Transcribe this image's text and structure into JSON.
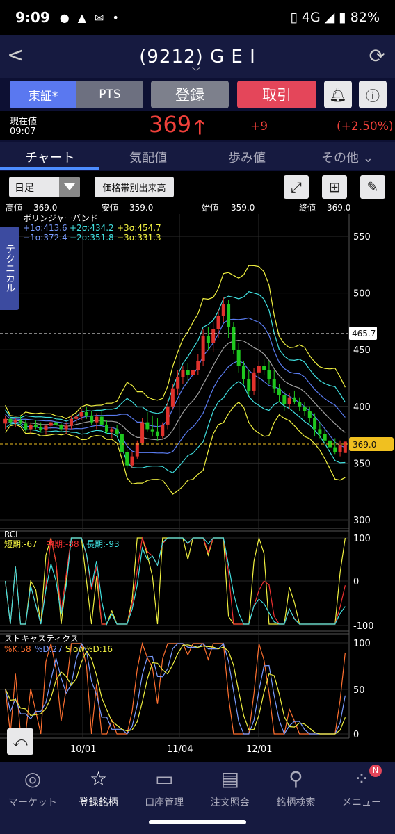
{
  "status": {
    "time": "9:09",
    "network": "4G",
    "battery": "82%"
  },
  "header": {
    "title": "(9212) G E I"
  },
  "buttons": {
    "market_tosho": "東証*",
    "market_pts": "PTS",
    "register": "登録",
    "trade": "取引"
  },
  "price": {
    "label": "現在値",
    "time": "09:07",
    "value": "369",
    "change": "+9",
    "change_pct": "(+2.50%)"
  },
  "tabs": [
    "チャート",
    "気配値",
    "歩み値",
    "その他"
  ],
  "toolbar": {
    "period": "日足",
    "volume_by_price": "価格帯別出来高"
  },
  "side_tab": "テクニカル",
  "ohlc": {
    "high_label": "高値",
    "high": "369.0",
    "low_label": "安値",
    "low": "359.0",
    "open_label": "始値",
    "open": "359.0",
    "close_label": "終値",
    "close": "369.0"
  },
  "bb_legend": {
    "title": "ボリンジャーバンド",
    "p1": "+1σ:413.6",
    "p2": "+2σ:434.2",
    "p3": "+3σ:454.7",
    "m1": "−1σ:372.4",
    "m2": "−2σ:351.8",
    "m3": "−3σ:331.3"
  },
  "rci_legend": {
    "title": "RCI",
    "short": "短期:-67",
    "mid": "中期:-88",
    "long": "長期:-93"
  },
  "stoch_legend": {
    "title": "ストキャスティクス",
    "k": "%K:58",
    "d": "%D:27",
    "slow": "Slow%D:16"
  },
  "price_axis": [
    "550",
    "500",
    "450",
    "400",
    "350",
    "300"
  ],
  "rci_axis": [
    "100",
    "0",
    "-100"
  ],
  "stoch_axis": [
    "100",
    "50",
    "0"
  ],
  "markers": {
    "upper": "465.7",
    "current": "369.0"
  },
  "dates": [
    "10/01",
    "11/04",
    "12/01"
  ],
  "colors": {
    "up": "#e0322c",
    "down": "#1ec81e",
    "bb_pm1": "#5a7cf0",
    "bb_pm2": "#40e0e0",
    "bb_pm3": "#f0f040",
    "bb_mid": "#a0a0a0",
    "price_red": "#f0403a",
    "accent": "#5a78f0"
  },
  "nav": [
    {
      "label": "マーケット",
      "icon": "globe-icon"
    },
    {
      "label": "登録銘柄",
      "icon": "star-icon"
    },
    {
      "label": "口座管理",
      "icon": "card-icon"
    },
    {
      "label": "注文照会",
      "icon": "document-icon"
    },
    {
      "label": "銘柄検索",
      "icon": "search-icon"
    },
    {
      "label": "メニュー",
      "icon": "grid-icon",
      "badge": "N"
    }
  ],
  "chart_data": [
    {
      "type": "candlestick",
      "ylim": [
        300,
        560
      ],
      "x": [
        "10/01",
        "11/04",
        "12/01"
      ],
      "candles": [
        [
          385,
          392,
          380,
          389
        ],
        [
          389,
          390,
          383,
          386
        ],
        [
          386,
          390,
          382,
          388
        ],
        [
          388,
          392,
          384,
          385
        ],
        [
          385,
          388,
          378,
          380
        ],
        [
          380,
          386,
          376,
          384
        ],
        [
          384,
          388,
          380,
          382
        ],
        [
          382,
          386,
          377,
          379
        ],
        [
          379,
          384,
          375,
          383
        ],
        [
          383,
          388,
          380,
          386
        ],
        [
          386,
          390,
          382,
          384
        ],
        [
          384,
          386,
          378,
          380
        ],
        [
          380,
          386,
          376,
          383
        ],
        [
          383,
          392,
          380,
          389
        ],
        [
          389,
          394,
          385,
          391
        ],
        [
          391,
          398,
          388,
          395
        ],
        [
          395,
          400,
          389,
          392
        ],
        [
          392,
          396,
          384,
          386
        ],
        [
          386,
          394,
          380,
          391
        ],
        [
          391,
          398,
          387,
          384
        ],
        [
          384,
          388,
          376,
          378
        ],
        [
          378,
          382,
          372,
          380
        ],
        [
          380,
          384,
          374,
          376
        ],
        [
          376,
          380,
          356,
          360
        ],
        [
          360,
          362,
          345,
          348
        ],
        [
          348,
          360,
          346,
          356
        ],
        [
          356,
          370,
          354,
          368
        ],
        [
          368,
          390,
          366,
          386
        ],
        [
          386,
          395,
          378,
          380
        ],
        [
          380,
          392,
          374,
          378
        ],
        [
          378,
          390,
          370,
          374
        ],
        [
          374,
          386,
          372,
          384
        ],
        [
          384,
          406,
          380,
          400
        ],
        [
          400,
          420,
          398,
          416
        ],
        [
          416,
          432,
          410,
          426
        ],
        [
          426,
          436,
          420,
          432
        ],
        [
          432,
          438,
          420,
          428
        ],
        [
          428,
          436,
          424,
          432
        ],
        [
          432,
          446,
          428,
          440
        ],
        [
          440,
          468,
          436,
          462
        ],
        [
          462,
          470,
          450,
          456
        ],
        [
          456,
          474,
          448,
          468
        ],
        [
          468,
          486,
          460,
          480
        ],
        [
          480,
          496,
          474,
          490
        ],
        [
          490,
          494,
          460,
          470
        ],
        [
          470,
          474,
          446,
          450
        ],
        [
          450,
          456,
          430,
          436
        ],
        [
          436,
          440,
          420,
          424
        ],
        [
          424,
          432,
          410,
          414
        ],
        [
          414,
          434,
          410,
          430
        ],
        [
          430,
          440,
          424,
          436
        ],
        [
          436,
          442,
          428,
          432
        ],
        [
          432,
          440,
          420,
          424
        ],
        [
          424,
          432,
          412,
          416
        ],
        [
          416,
          420,
          404,
          410
        ],
        [
          410,
          414,
          396,
          402
        ],
        [
          402,
          412,
          398,
          408
        ],
        [
          408,
          414,
          402,
          404
        ],
        [
          404,
          408,
          396,
          400
        ],
        [
          400,
          404,
          392,
          396
        ],
        [
          396,
          400,
          386,
          390
        ],
        [
          390,
          394,
          374,
          380
        ],
        [
          380,
          386,
          372,
          376
        ],
        [
          376,
          380,
          366,
          370
        ],
        [
          370,
          374,
          360,
          364
        ],
        [
          364,
          372,
          358,
          360
        ],
        [
          360,
          370,
          356,
          366
        ],
        [
          359,
          369,
          359,
          369
        ]
      ]
    },
    {
      "type": "line",
      "title": "RCI",
      "ylim": [
        -100,
        100
      ],
      "series": [
        {
          "name": "短期"
        },
        {
          "name": "中期"
        },
        {
          "name": "長期"
        }
      ]
    },
    {
      "type": "line",
      "title": "ストキャスティクス",
      "ylim": [
        0,
        100
      ],
      "series": [
        {
          "name": "%K"
        },
        {
          "name": "%D"
        },
        {
          "name": "Slow%D"
        }
      ]
    }
  ]
}
